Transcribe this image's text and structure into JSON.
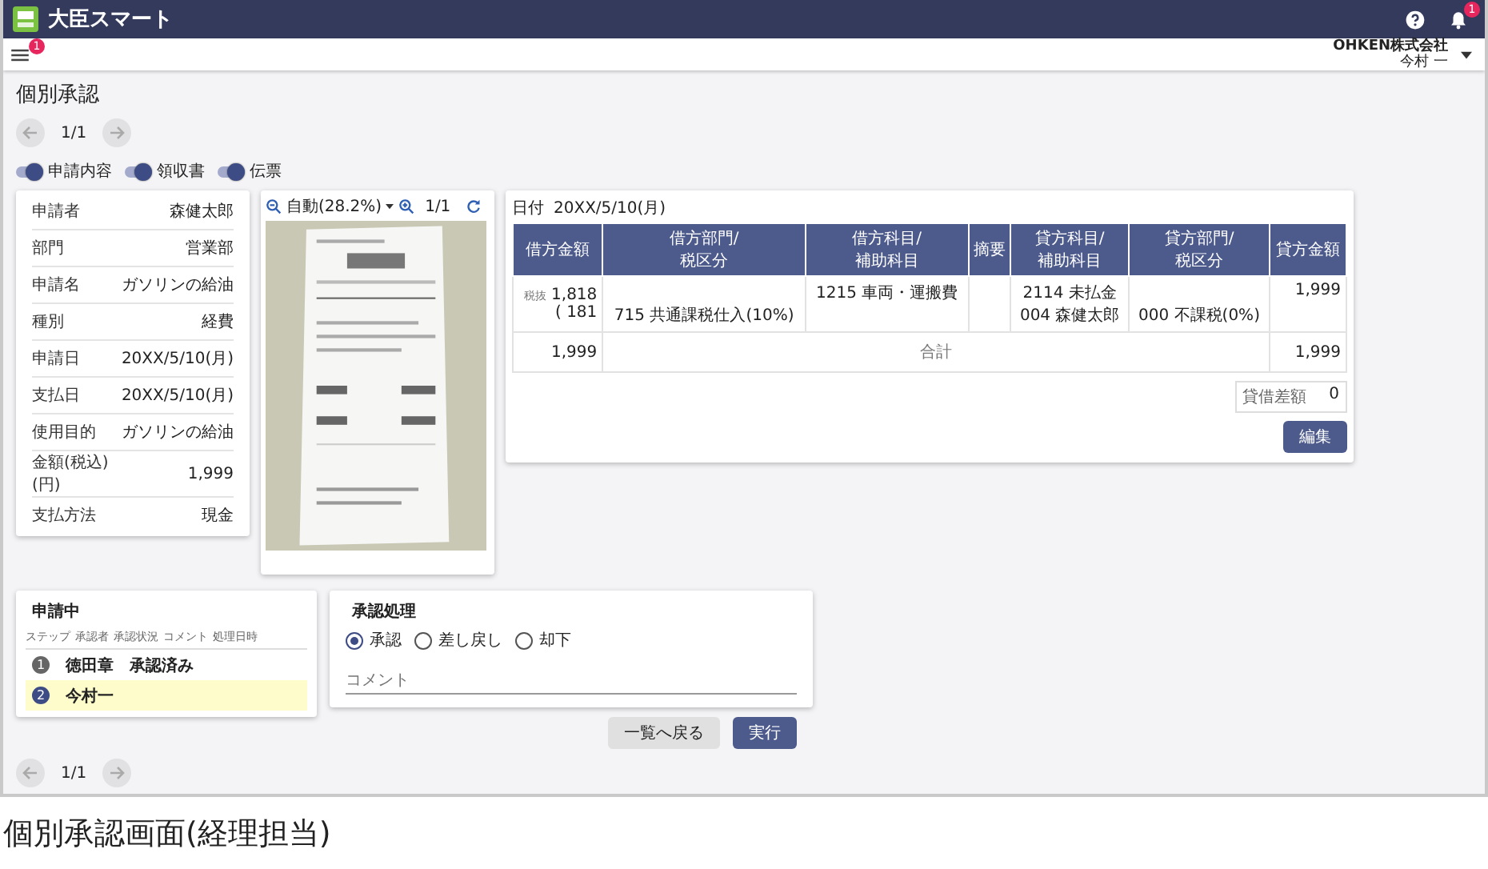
{
  "app": {
    "title": "大臣スマート",
    "notification_badge": "1",
    "menu_badge": "1",
    "company": "OHKEN株式会社",
    "user": "今村 一"
  },
  "page_title": "個別承認",
  "pager": {
    "label": "1/1"
  },
  "bottom_pager": {
    "label": "1/1"
  },
  "toggles": [
    {
      "label": "申請内容",
      "on": true
    },
    {
      "label": "領収書",
      "on": true
    },
    {
      "label": "伝票",
      "on": true
    }
  ],
  "application": [
    {
      "label": "申請者",
      "value": "森健太郎"
    },
    {
      "label": "部門",
      "value": "営業部"
    },
    {
      "label": "申請名",
      "value": "ガソリンの給油"
    },
    {
      "label": "種別",
      "value": "経費"
    },
    {
      "label": "申請日",
      "value": "20XX/5/10(月)"
    },
    {
      "label": "支払日",
      "value": "20XX/5/10(月)"
    },
    {
      "label": "使用目的",
      "value": "ガソリンの給油"
    },
    {
      "label": "金額(税込)(円)",
      "value": "1,999"
    },
    {
      "label": "支払方法",
      "value": "現金"
    }
  ],
  "viewer": {
    "zoom": "自動(28.2%)",
    "page": "1/1",
    "kind": "picture"
  },
  "journal": {
    "date_label": "日付",
    "date": "20XX/5/10(月)",
    "columns": [
      [
        "借方金額"
      ],
      [
        "借方部門/",
        "税区分"
      ],
      [
        "借方科目/",
        "補助科目"
      ],
      [
        "摘要"
      ],
      [
        "貸方科目/",
        "補助科目"
      ],
      [
        "貸方部門/",
        "税区分"
      ],
      [
        "貸方金額"
      ]
    ],
    "entry": {
      "tax_label": "税抜",
      "debit_amount": "1,818",
      "debit_tax": "( 181",
      "debit_dept": "715 共通課税仕入(10%)",
      "debit_account": "1215 車両・運搬費",
      "credit_account": "2114 未払金",
      "credit_sub": "004 森健太郎",
      "credit_dept": "000 不課税(0%)",
      "credit_amount": "1,999"
    },
    "total": {
      "debit": "1,999",
      "label": "合計",
      "credit": "1,999"
    },
    "difference": {
      "label": "貸借差額",
      "value": "0"
    },
    "edit_button": "編集"
  },
  "flow": {
    "title": "申請中",
    "columns": [
      "ステップ",
      "承認者",
      "承認状況",
      "コメント",
      "処理日時"
    ],
    "steps": [
      {
        "step": "1",
        "approver": "徳田章",
        "status": "承認済み",
        "current": false
      },
      {
        "step": "2",
        "approver": "今村一",
        "current": true
      }
    ]
  },
  "approval": {
    "title": "承認処理",
    "options": [
      {
        "label": "承認",
        "selected": true
      },
      {
        "label": "差し戻し",
        "selected": false
      },
      {
        "label": "却下",
        "selected": false
      }
    ],
    "comment_placeholder": "コメント"
  },
  "buttons": {
    "back": "一覧へ戻る",
    "execute": "実行"
  },
  "caption": "個別承認画面(経理担当)"
}
